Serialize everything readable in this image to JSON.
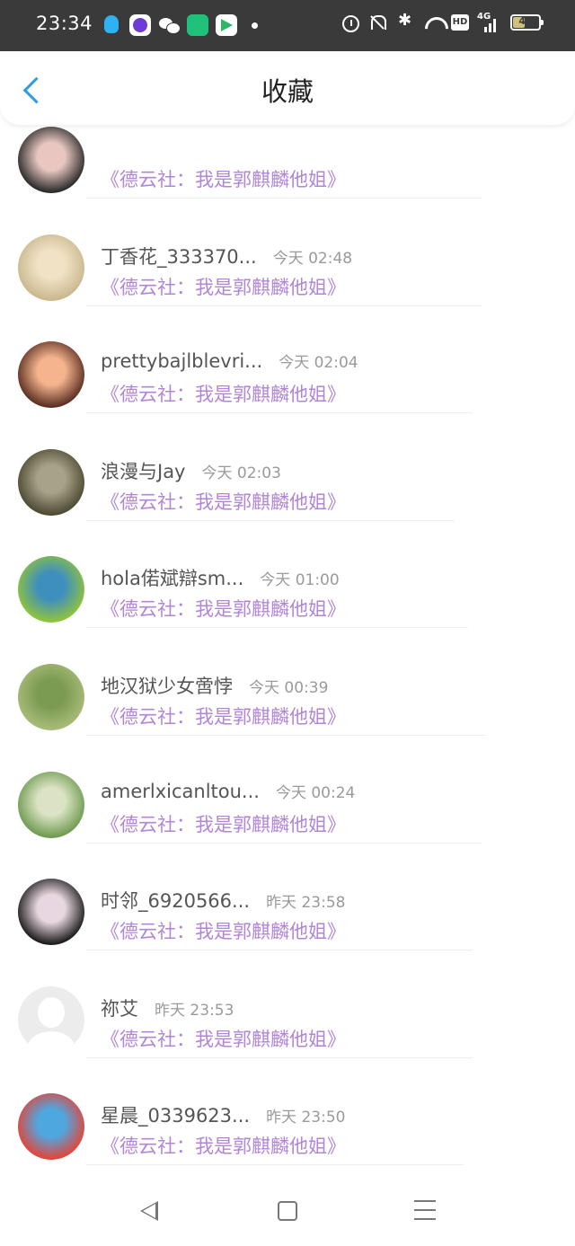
{
  "status_bar": {
    "time": "23:34",
    "app_icons": [
      "qq-icon",
      "app-purple-icon",
      "wechat-icon",
      "app-green-icon",
      "play-icon"
    ],
    "network": "4G",
    "hd_label": "HD",
    "battery": "45",
    "battery_level": 0.45
  },
  "header": {
    "title": "收藏",
    "back_icon": "chevron-left-icon"
  },
  "items": [
    {
      "name": "",
      "time": "",
      "title": "《德云社：我是郭麒麟他姐》",
      "avatar_colors": [
        "#2b2b2b",
        "#e9c7c0"
      ]
    },
    {
      "name": "丁香花_333370...",
      "time": "今天 02:48",
      "title": "《德云社：我是郭麒麟他姐》",
      "avatar_colors": [
        "#c9b88e",
        "#f1e2c6"
      ]
    },
    {
      "name": "prettybajlblevri...",
      "time": "今天 02:04",
      "title": "《德云社：我是郭麒麟他姐》",
      "avatar_colors": [
        "#5a2f23",
        "#f5b48d"
      ]
    },
    {
      "name": "浪漫与Jay",
      "time": "今天 02:03",
      "title": "《德云社：我是郭麒麟他姐》",
      "avatar_colors": [
        "#4e4a33",
        "#a7a38a"
      ]
    },
    {
      "name": "hola偌斌辯sm...",
      "time": "今天 01:00",
      "title": "《德云社：我是郭麒麟他姐》",
      "avatar_colors": [
        "#8fc33d",
        "#3f8fbe"
      ]
    },
    {
      "name": "地汉狱少女啻悖",
      "time": "今天 00:39",
      "title": "《德云社：我是郭麒麟他姐》",
      "avatar_colors": [
        "#a7bb78",
        "#7c9b52"
      ]
    },
    {
      "name": "amerlxicanltou...",
      "time": "今天 00:24",
      "title": "《德云社：我是郭麒麟他姐》",
      "avatar_colors": [
        "#6f9b52",
        "#dbe3c4"
      ]
    },
    {
      "name": "时邻_6920566...",
      "time": "昨天 23:58",
      "title": "《德云社：我是郭麒麟他姐》",
      "avatar_colors": [
        "#1c1c1c",
        "#e8d7e0"
      ]
    },
    {
      "name": "祢艾",
      "time": "昨天 23:53",
      "title": "《德云社：我是郭麒麟他姐》",
      "avatar_colors": []
    },
    {
      "name": "星晨_0339623...",
      "time": "昨天 23:50",
      "title": "《德云社：我是郭麒麟他姐》",
      "avatar_colors": [
        "#e2463b",
        "#4fa7e0"
      ]
    }
  ],
  "nav_bar": {
    "icons": [
      "back-triangle-icon",
      "home-square-icon",
      "menu-lines-icon"
    ]
  }
}
